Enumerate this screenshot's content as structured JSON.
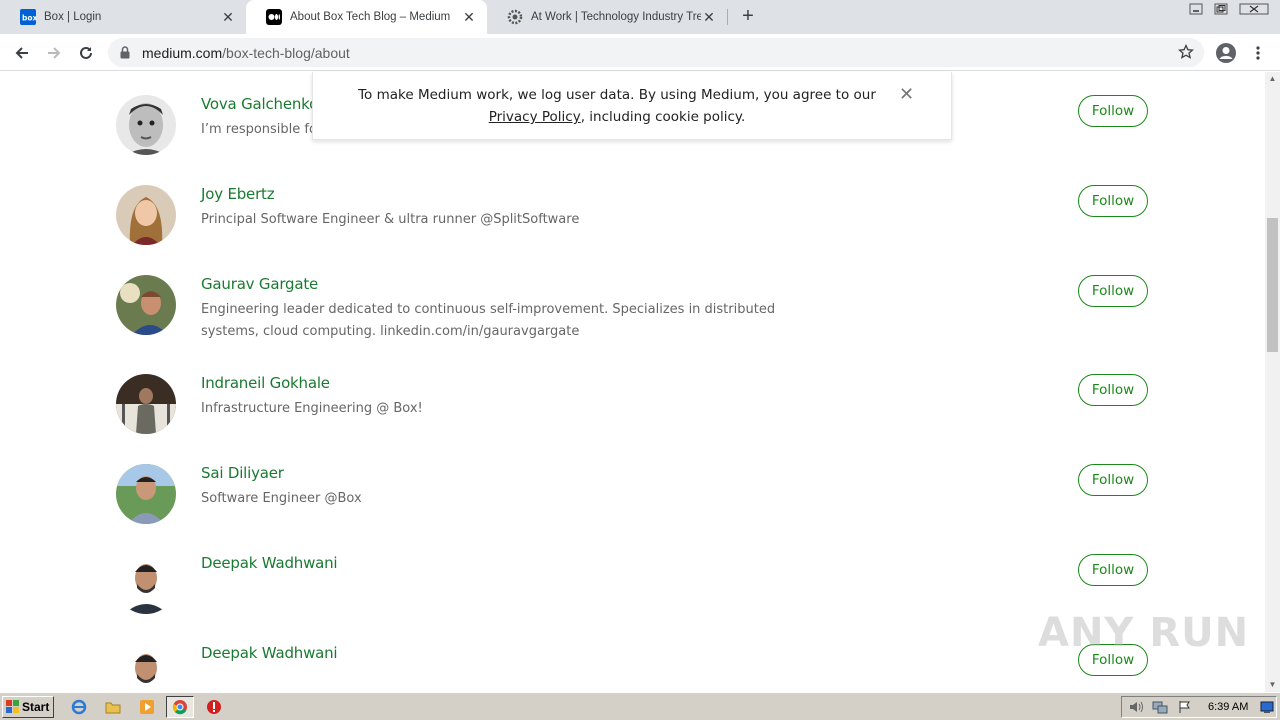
{
  "browser": {
    "tabs": [
      {
        "title": "Box | Login",
        "favicon": "box-favicon"
      },
      {
        "title": "About Box Tech Blog – Medium",
        "favicon": "medium-favicon"
      },
      {
        "title": "At Work | Technology Industry Trends",
        "favicon": "gear-favicon"
      }
    ],
    "url_domain": "medium.com",
    "url_path": "/box-tech-blog/about"
  },
  "cookie_banner": {
    "text_before": "To make Medium work, we log user data. By using Medium, you agree to our ",
    "link": "Privacy Policy",
    "text_after": ", including cookie policy."
  },
  "members": [
    {
      "name": "Vova Galchenko",
      "bio": "I’m responsible for",
      "follow": "Follow"
    },
    {
      "name": "Joy Ebertz",
      "bio": "Principal Software Engineer & ultra runner @SplitSoftware",
      "follow": "Follow"
    },
    {
      "name": "Gaurav Gargate",
      "bio": "Engineering leader dedicated to continuous self-improvement. Specializes in distributed systems, cloud computing. linkedin.com/in/gauravgargate",
      "follow": "Follow"
    },
    {
      "name": "Indraneil Gokhale",
      "bio": "Infrastructure Engineering @ Box!",
      "follow": "Follow"
    },
    {
      "name": "Sai Diliyaer",
      "bio": "Software Engineer @Box",
      "follow": "Follow"
    },
    {
      "name": "Deepak Wadhwani",
      "bio": "",
      "follow": "Follow"
    },
    {
      "name": "Deepak Wadhwani",
      "bio": "",
      "follow": "Follow"
    }
  ],
  "watermark": "ANY RUN",
  "taskbar": {
    "start_label": "Start",
    "clock": "6:39 AM"
  },
  "colors": {
    "name_green": "#1a7a30",
    "follow_green": "#1a8917",
    "tabstrip": "#dee1e6"
  }
}
